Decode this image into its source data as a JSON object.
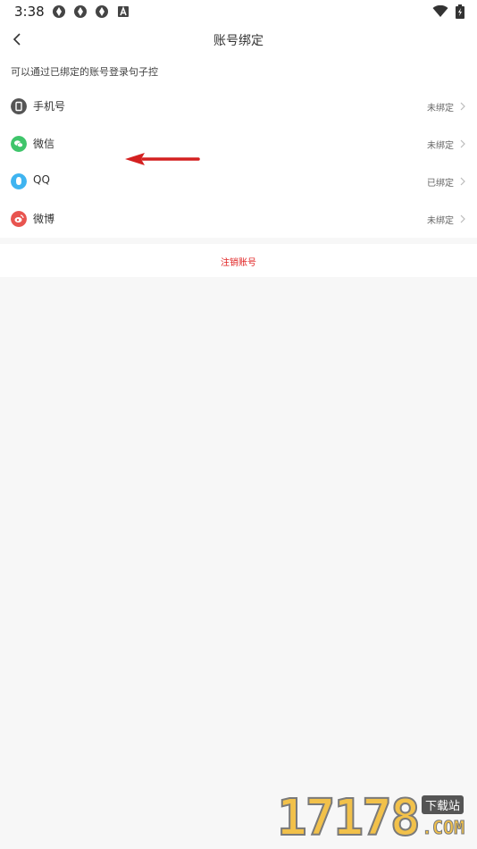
{
  "status_bar": {
    "time": "3:38",
    "notification_icons": [
      "sync-icon",
      "sync-icon",
      "sync-icon",
      "a-icon"
    ],
    "right_icons": [
      "wifi-icon",
      "battery-charging-icon"
    ]
  },
  "header": {
    "title": "账号绑定",
    "back_icon": "chevron-left-icon"
  },
  "hint": "可以通过已绑定的账号登录句子控",
  "accounts": [
    {
      "label": "手机号",
      "status": "未绑定",
      "icon": "phone-icon",
      "color": "#555555"
    },
    {
      "label": "微信",
      "status": "未绑定",
      "icon": "wechat-icon",
      "color": "#3fc56b"
    },
    {
      "label": "QQ",
      "status": "已绑定",
      "icon": "qq-icon",
      "color": "#3fb4f0"
    },
    {
      "label": "微博",
      "status": "未绑定",
      "icon": "weibo-icon",
      "color": "#e8544f"
    }
  ],
  "cancel_account": "注销账号",
  "colors": {
    "accent_red": "#e02020",
    "background": "#f7f7f7"
  },
  "watermark": {
    "number": "17178",
    "badge": "下载站",
    "domain": ".COM"
  }
}
